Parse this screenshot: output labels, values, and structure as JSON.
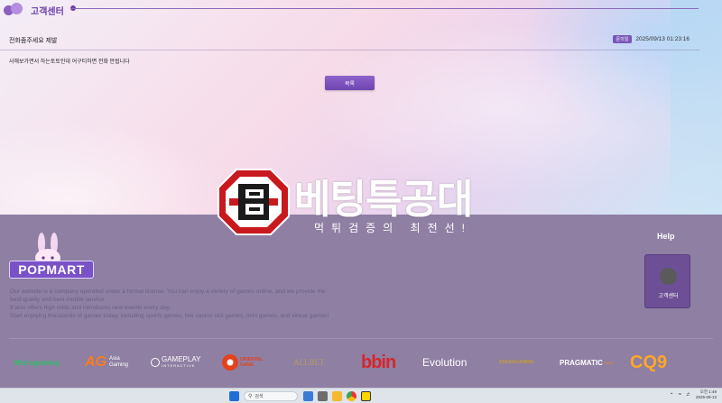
{
  "header": {
    "title": "고객센터"
  },
  "post": {
    "title": "전화좀주세요 제발",
    "badge": "문의일",
    "date": "2025/09/13 01:23:16",
    "body": "사해보가면서 하는토토인데 어구티하면 전화 안됩니다"
  },
  "buttons": {
    "list_label": "목록"
  },
  "brand": {
    "name": "베팅특공대",
    "slogan": "먹튀검증의 최전선!"
  },
  "popmart": {
    "label": "POPMART"
  },
  "about": {
    "lines": [
      "Our website is a company operated under a formal license. You can enjoy a variety of games online, and we provide the",
      "best quality and best mobile service.",
      "It also offers high odds and introduces new events every day.",
      "Start enjoying thousands of games today, including sports games, live casino slot games, mini games, and virtual games!"
    ]
  },
  "help": {
    "title": "Help",
    "label": "고객센터"
  },
  "vendors": [
    {
      "name": "Microgaming",
      "color": "#2fbf6a"
    },
    {
      "name": "Asia Gaming",
      "mark": "AG",
      "color": "#ff7a1a"
    },
    {
      "name": "GAMEPLAY",
      "sub": "INTERACTIVE",
      "color": "#ffffff"
    },
    {
      "name": "ORIENTAL",
      "sub": "GAME",
      "color": "#e2421c"
    },
    {
      "name": "ALLBET",
      "color": "#b89a64"
    },
    {
      "name": "bbin",
      "color": "#d6262c"
    },
    {
      "name": "Evolution",
      "color": "#ffffff"
    },
    {
      "name": "DREAMGAMING",
      "color": "#c79a3a"
    },
    {
      "name": "PRAGMATIC",
      "sub": "PLAY",
      "color": "#ffffff"
    },
    {
      "name": "CQ9",
      "color": "#ffa726"
    }
  ],
  "taskbar": {
    "search_placeholder": "검색",
    "time": "오전 1:49",
    "date": "2025-09-13"
  }
}
